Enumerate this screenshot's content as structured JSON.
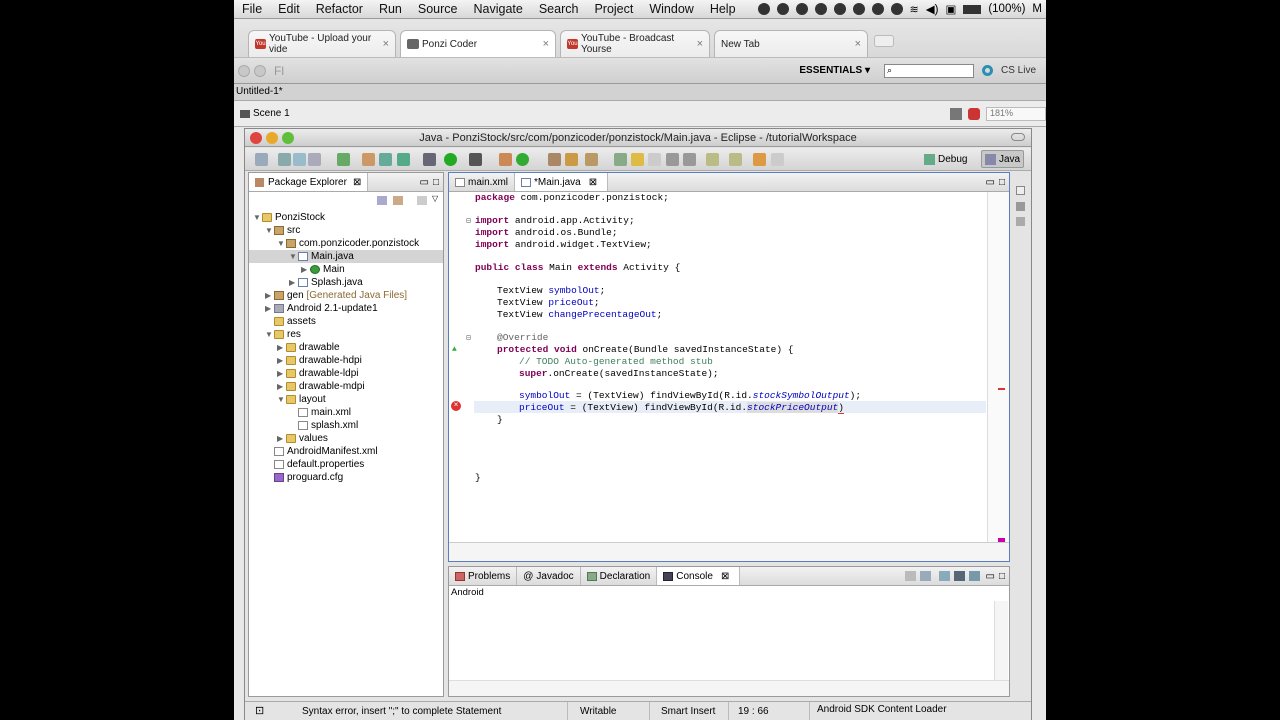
{
  "mac_menu": {
    "items": [
      "File",
      "Edit",
      "Refactor",
      "Run",
      "Source",
      "Navigate",
      "Search",
      "Project",
      "Window",
      "Help"
    ],
    "battery": "(100%)",
    "user_initial": "M"
  },
  "browser_tabs": [
    {
      "label": "YouTube - Upload your vide",
      "close": "×"
    },
    {
      "label": "Ponzi Coder",
      "close": "×"
    },
    {
      "label": "YouTube - Broadcast Yourse",
      "close": "×"
    },
    {
      "label": "New Tab",
      "close": "×"
    }
  ],
  "flash": {
    "fl_label": "Fl",
    "essentials": "ESSENTIALS ▾",
    "search_placeholder": "",
    "cs_live": "CS Live",
    "doc_tab": "Untitled-1*",
    "scene": "Scene 1",
    "zoom": "181%"
  },
  "eclipse": {
    "title": "Java - PonziStock/src/com/ponzicoder/ponzistock/Main.java - Eclipse - /tutorialWorkspace",
    "perspectives": [
      "Debug",
      "Java"
    ],
    "package_explorer": {
      "title": "Package Explorer",
      "tree": [
        {
          "label": "PonziStock"
        },
        {
          "label": "src"
        },
        {
          "label": "com.ponzicoder.ponzistock"
        },
        {
          "label": "Main.java"
        },
        {
          "label": "Main"
        },
        {
          "label": "Splash.java"
        },
        {
          "label": "gen",
          "suffix": "[Generated Java Files]"
        },
        {
          "label": "Android 2.1-update1"
        },
        {
          "label": "assets"
        },
        {
          "label": "res"
        },
        {
          "label": "drawable"
        },
        {
          "label": "drawable-hdpi"
        },
        {
          "label": "drawable-ldpi"
        },
        {
          "label": "drawable-mdpi"
        },
        {
          "label": "layout"
        },
        {
          "label": "main.xml"
        },
        {
          "label": "splash.xml"
        },
        {
          "label": "values"
        },
        {
          "label": "AndroidManifest.xml"
        },
        {
          "label": "default.properties"
        },
        {
          "label": "proguard.cfg"
        }
      ]
    },
    "editor_tabs": [
      {
        "label": "main.xml"
      },
      {
        "label": "*Main.java"
      }
    ],
    "code": {
      "l1": [
        "package",
        " com.ponzicoder.ponzistock;"
      ],
      "l2": [
        "import",
        " android.app.Activity;"
      ],
      "l3": [
        "import",
        " android.os.Bundle;"
      ],
      "l4": [
        "import",
        " android.widget.TextView;"
      ],
      "l5": [
        "public",
        " ",
        "class",
        " Main ",
        "extends",
        " Activity {"
      ],
      "l6": [
        "TextView ",
        "symbolOut",
        ";"
      ],
      "l7": [
        "TextView ",
        "priceOut",
        ";"
      ],
      "l8": [
        "TextView ",
        "changePrecentageOut",
        ";"
      ],
      "l9": "@Override",
      "l10": [
        "protected",
        " ",
        "void",
        " onCreate(Bundle savedInstanceState) {"
      ],
      "l11": "// TODO Auto-generated method stub",
      "l12": [
        "super",
        ".onCreate(savedInstanceState);"
      ],
      "l13": [
        "symbolOut",
        " = (TextView) findViewById(R.id.",
        "stockSymbolOutput",
        ");"
      ],
      "l14": [
        "priceOut",
        " = (TextView) findViewById(R.id.",
        "stockPriceOutput",
        ")"
      ],
      "l15": "}",
      "l16": "}"
    },
    "bottom_tabs": [
      {
        "label": "Problems"
      },
      {
        "label": "Javadoc"
      },
      {
        "label": "Declaration"
      },
      {
        "label": "Console"
      }
    ],
    "console_name": "Android",
    "status": {
      "message": "Syntax error, insert \";\" to complete Statement",
      "writable": "Writable",
      "insert_mode": "Smart Insert",
      "position": "19 : 66",
      "loader": "Android SDK Content Loader"
    }
  },
  "colors": {
    "keyword": "#7f0055",
    "comment": "#3f7f5f",
    "field": "#0000c0",
    "selection": "#c9d9f0"
  }
}
